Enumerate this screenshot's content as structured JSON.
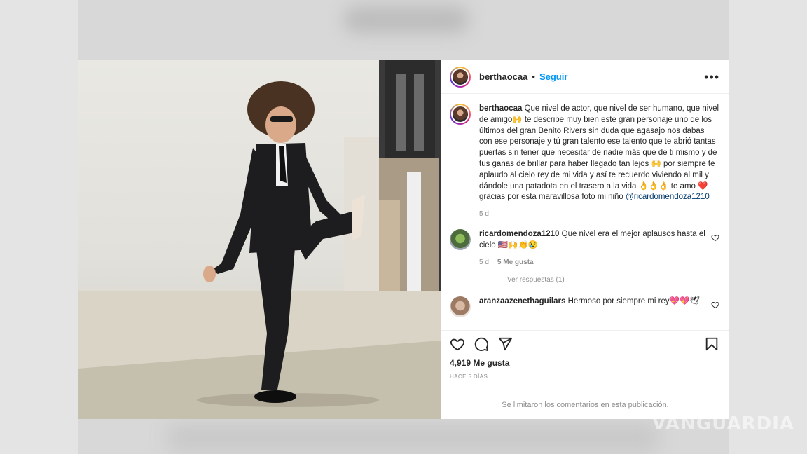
{
  "watermark": "VANGUARDIA",
  "post": {
    "username": "berthaocaa",
    "separator": "•",
    "follow_label": "Seguir",
    "more_label": "•••",
    "caption": {
      "author": "berthaocaa",
      "text": "Que nivel de actor, que nivel de ser humano, que nivel de amigo🙌 te describe muy bien este gran personaje uno de los últimos del gran Benito Rivers sin duda que agasajo nos dabas con ese personaje y tú gran talento ese talento que te abrió tantas puertas sin tener que necesitar de nadie más que de ti mismo y de tus ganas de brillar para haber llegado tan lejos 🙌 por siempre te aplaudo al cielo rey de mi vida y así te recuerdo viviendo al mil y dándole una patadota en el trasero a la vida 👌👌👌 te amo ❤️ gracias por esta maravillosa foto mi niño",
      "mention": "@ricardomendoza1210",
      "age": "5 d"
    },
    "comments": [
      {
        "author": "ricardomendoza1210",
        "text": "Que nivel era el mejor aplausos hasta el cielo 🇺🇸🙌👏😢",
        "age": "5 d",
        "likes": "5 Me gusta",
        "replies_label": "Ver respuestas (1)"
      },
      {
        "author": "aranzaazenethaguilars",
        "text": "Hermoso por siempre mi rey💖💖🕊"
      }
    ],
    "likes_count": "4,919 Me gusta",
    "posted_time": "HACE 5 DÍAS",
    "comments_disabled": "Se limitaron los comentarios en esta publicación."
  }
}
